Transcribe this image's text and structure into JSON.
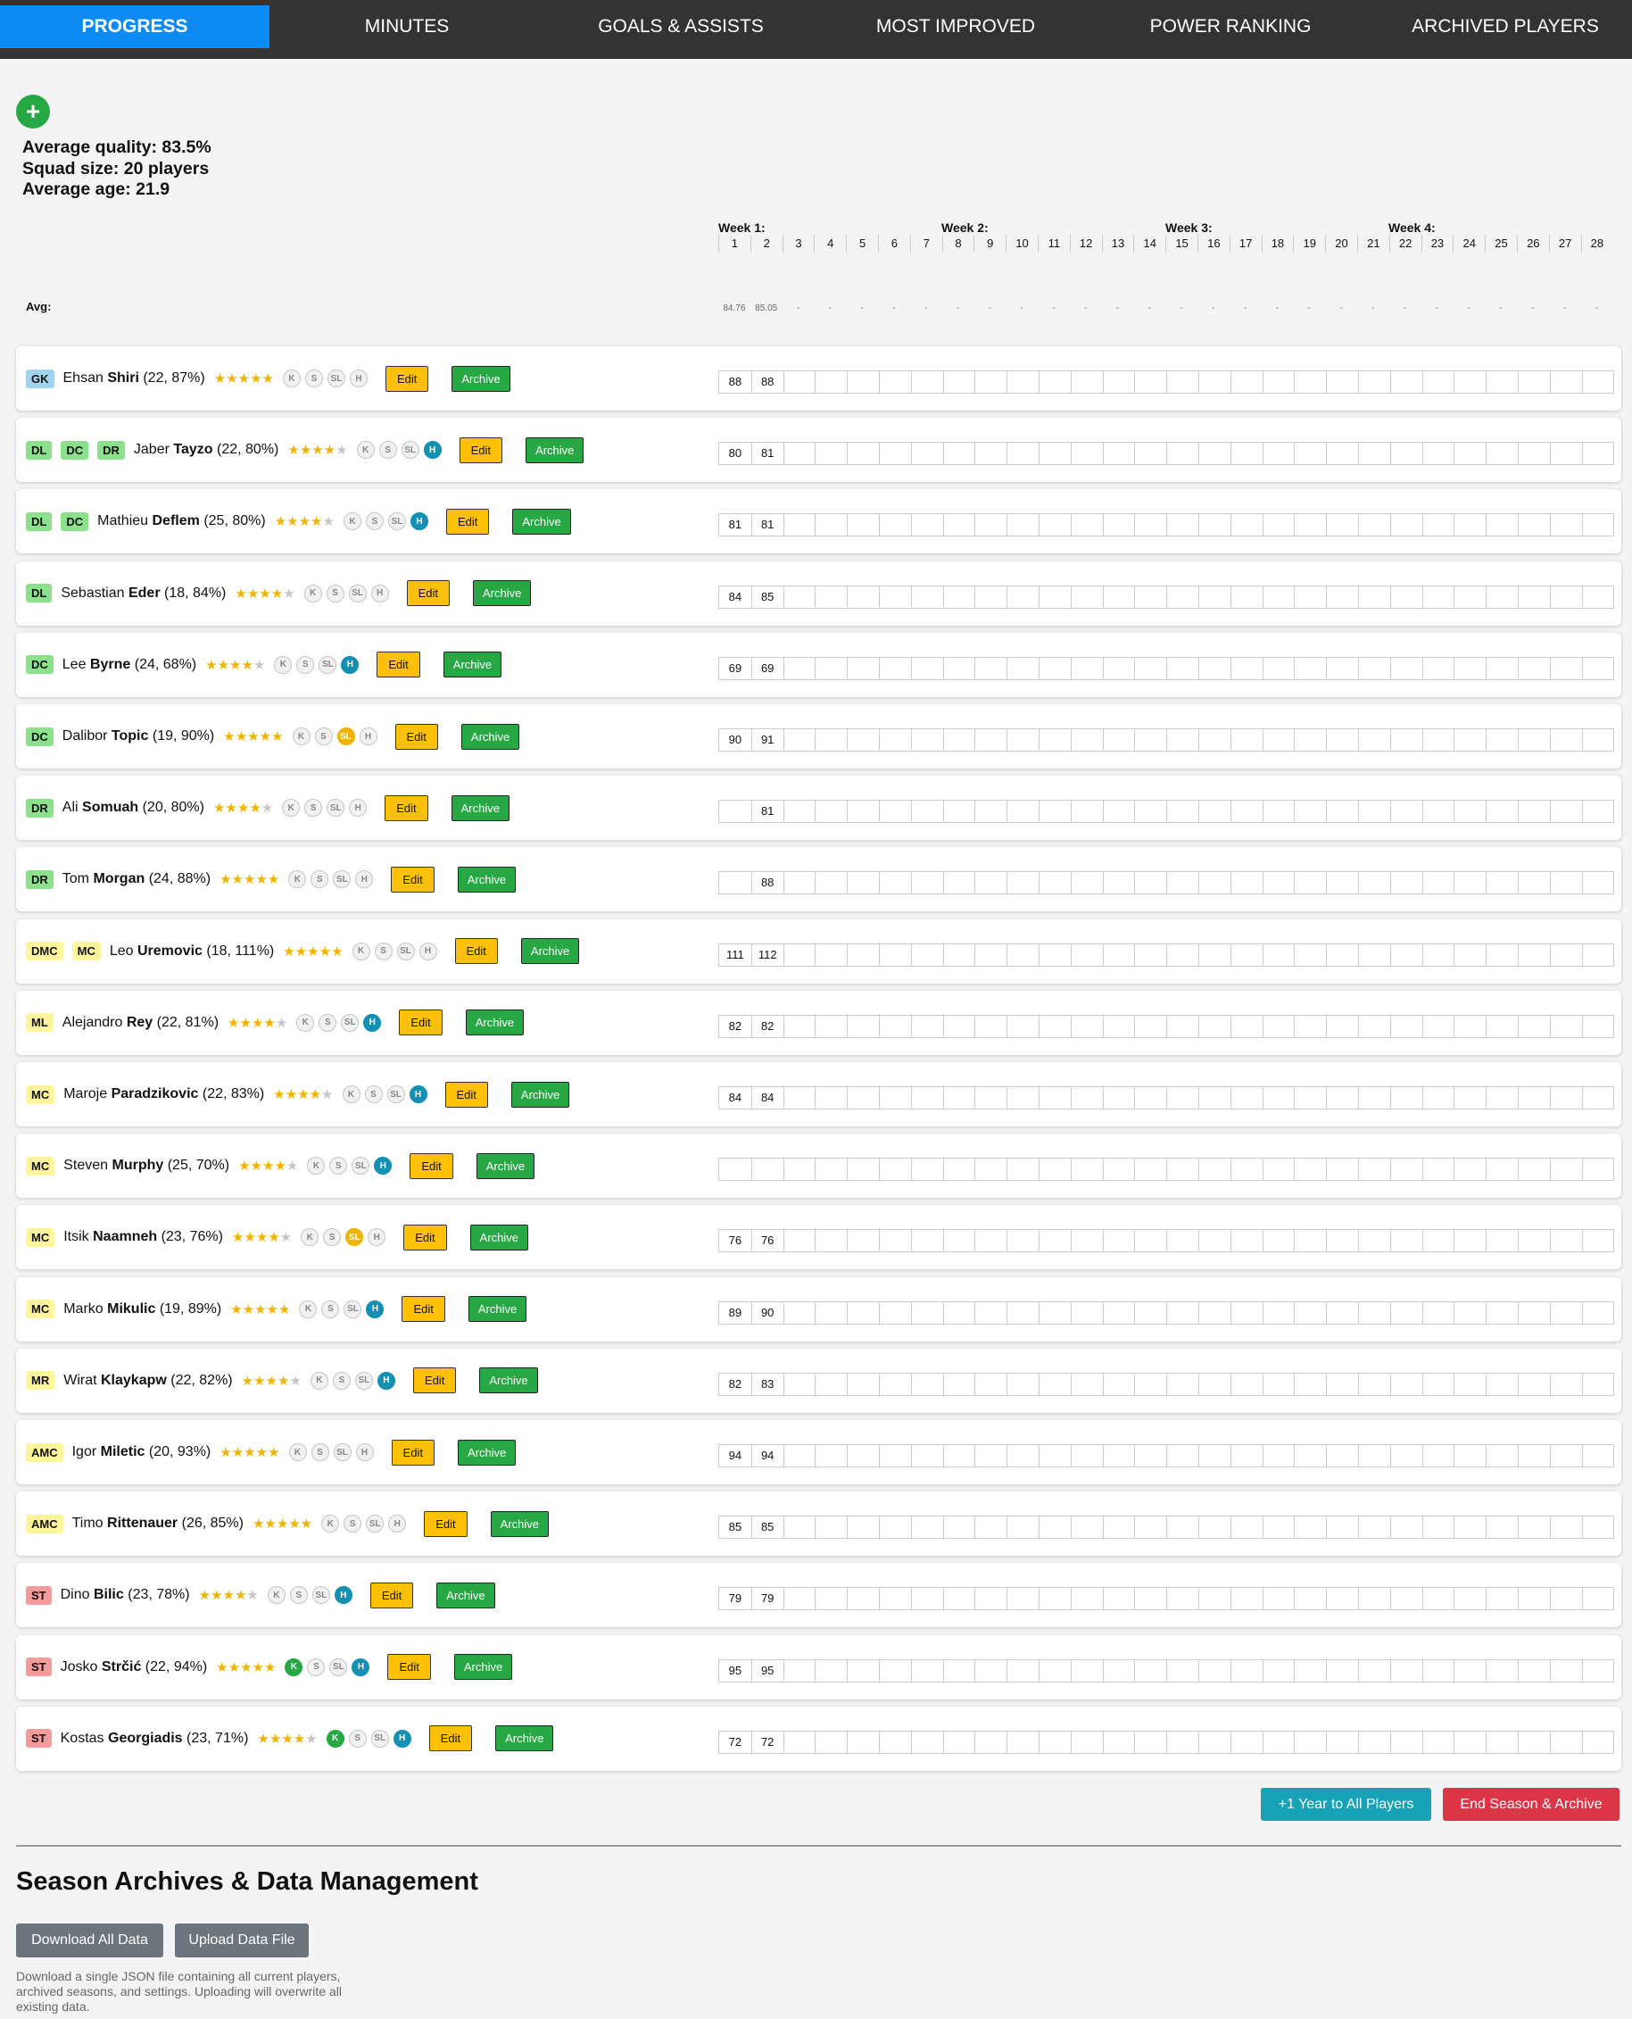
{
  "nav": {
    "tabs": [
      "PROGRESS",
      "MINUTES",
      "GOALS & ASSISTS",
      "MOST IMPROVED",
      "POWER RANKING",
      "ARCHIVED PLAYERS"
    ]
  },
  "add_button": "+",
  "stats": {
    "avg_quality": "Average quality: 83.5%",
    "squad_size": "Squad size: 20 players",
    "avg_age": "Average age: 21.9"
  },
  "weeks": [
    "Week 1:",
    "Week 2:",
    "Week 3:",
    "Week 4:"
  ],
  "avg_label": "Avg:",
  "averages": [
    "84.76",
    "85.05"
  ],
  "badge_labels": [
    "K",
    "S",
    "SL",
    "H"
  ],
  "edit_label": "Edit",
  "archive_label": "Archive",
  "players": [
    {
      "positions": [
        "GK"
      ],
      "first": "Ehsan",
      "last": "Shiri",
      "details": "(22, 87%)",
      "stars": 4.5,
      "badges": {
        "K": false,
        "S": false,
        "SL": false,
        "H": false
      },
      "values": [
        "88",
        "88"
      ]
    },
    {
      "positions": [
        "DL",
        "DC",
        "DR"
      ],
      "first": "Jaber",
      "last": "Tayzo",
      "details": "(22, 80%)",
      "stars": 4,
      "badges": {
        "K": false,
        "S": false,
        "SL": false,
        "H": true
      },
      "values": [
        "80",
        "81"
      ]
    },
    {
      "positions": [
        "DL",
        "DC"
      ],
      "first": "Mathieu",
      "last": "Deflem",
      "details": "(25, 80%)",
      "stars": 4,
      "badges": {
        "K": false,
        "S": false,
        "SL": false,
        "H": true
      },
      "values": [
        "81",
        "81"
      ]
    },
    {
      "positions": [
        "DL"
      ],
      "first": "Sebastian",
      "last": "Eder",
      "details": "(18, 84%)",
      "stars": 4,
      "badges": {
        "K": false,
        "S": false,
        "SL": false,
        "H": false
      },
      "values": [
        "84",
        "85"
      ]
    },
    {
      "positions": [
        "DC"
      ],
      "first": "Lee",
      "last": "Byrne",
      "details": "(24, 68%)",
      "stars": 3.5,
      "badges": {
        "K": false,
        "S": false,
        "SL": false,
        "H": true
      },
      "values": [
        "69",
        "69"
      ]
    },
    {
      "positions": [
        "DC"
      ],
      "first": "Dalibor",
      "last": "Topic",
      "details": "(19, 90%)",
      "stars": 4.5,
      "badges": {
        "K": false,
        "S": false,
        "SL": true,
        "H": false
      },
      "values": [
        "90",
        "91"
      ]
    },
    {
      "positions": [
        "DR"
      ],
      "first": "Ali",
      "last": "Somuah",
      "details": "(20, 80%)",
      "stars": 4,
      "badges": {
        "K": false,
        "S": false,
        "SL": false,
        "H": false
      },
      "values": [
        "",
        "81"
      ]
    },
    {
      "positions": [
        "DR"
      ],
      "first": "Tom",
      "last": "Morgan",
      "details": "(24, 88%)",
      "stars": 4.5,
      "badges": {
        "K": false,
        "S": false,
        "SL": false,
        "H": false
      },
      "values": [
        "",
        "88"
      ]
    },
    {
      "positions": [
        "DMC",
        "MC"
      ],
      "first": "Leo",
      "last": "Uremovic",
      "details": "(18, 111%)",
      "stars": 5,
      "badges": {
        "K": false,
        "S": false,
        "SL": false,
        "H": false
      },
      "values": [
        "111",
        "112"
      ]
    },
    {
      "positions": [
        "ML"
      ],
      "first": "Alejandro",
      "last": "Rey",
      "details": "(22, 81%)",
      "stars": 4,
      "badges": {
        "K": false,
        "S": false,
        "SL": false,
        "H": true
      },
      "values": [
        "82",
        "82"
      ]
    },
    {
      "positions": [
        "MC"
      ],
      "first": "Maroje",
      "last": "Paradzikovic",
      "details": "(22, 83%)",
      "stars": 4,
      "badges": {
        "K": false,
        "S": false,
        "SL": false,
        "H": true
      },
      "values": [
        "84",
        "84"
      ]
    },
    {
      "positions": [
        "MC"
      ],
      "first": "Steven",
      "last": "Murphy",
      "details": "(25, 70%)",
      "stars": 3.5,
      "badges": {
        "K": false,
        "S": false,
        "SL": false,
        "H": true
      },
      "values": [
        "",
        ""
      ]
    },
    {
      "positions": [
        "MC"
      ],
      "first": "Itsik",
      "last": "Naamneh",
      "details": "(23, 76%)",
      "stars": 4,
      "badges": {
        "K": false,
        "S": false,
        "SL": true,
        "H": false
      },
      "values": [
        "76",
        "76"
      ]
    },
    {
      "positions": [
        "MC"
      ],
      "first": "Marko",
      "last": "Mikulic",
      "details": "(19, 89%)",
      "stars": 4.5,
      "badges": {
        "K": false,
        "S": false,
        "SL": false,
        "H": true
      },
      "values": [
        "89",
        "90"
      ]
    },
    {
      "positions": [
        "MR"
      ],
      "first": "Wirat",
      "last": "Klaykapw",
      "details": "(22, 82%)",
      "stars": 4,
      "badges": {
        "K": false,
        "S": false,
        "SL": false,
        "H": true
      },
      "values": [
        "82",
        "83"
      ]
    },
    {
      "positions": [
        "AMC"
      ],
      "first": "Igor",
      "last": "Miletic",
      "details": "(20, 93%)",
      "stars": 5,
      "badges": {
        "K": false,
        "S": false,
        "SL": false,
        "H": false
      },
      "values": [
        "94",
        "94"
      ]
    },
    {
      "positions": [
        "AMC"
      ],
      "first": "Timo",
      "last": "Rittenauer",
      "details": "(26, 85%)",
      "stars": 4.5,
      "badges": {
        "K": false,
        "S": false,
        "SL": false,
        "H": false
      },
      "values": [
        "85",
        "85"
      ]
    },
    {
      "positions": [
        "ST"
      ],
      "first": "Dino",
      "last": "Bilic",
      "details": "(23, 78%)",
      "stars": 4,
      "badges": {
        "K": false,
        "S": false,
        "SL": false,
        "H": true
      },
      "values": [
        "79",
        "79"
      ]
    },
    {
      "positions": [
        "ST"
      ],
      "first": "Josko",
      "last": "Strčić",
      "details": "(22, 94%)",
      "stars": 5,
      "badges": {
        "K": true,
        "S": false,
        "SL": false,
        "H": true
      },
      "values": [
        "95",
        "95"
      ]
    },
    {
      "positions": [
        "ST"
      ],
      "first": "Kostas",
      "last": "Georgiadis",
      "details": "(23, 71%)",
      "stars": 3.5,
      "badges": {
        "K": true,
        "S": false,
        "SL": false,
        "H": true
      },
      "values": [
        "72",
        "72"
      ]
    }
  ],
  "footer": {
    "year_button": "+1 Year to All Players",
    "end_season_button": "End Season & Archive",
    "section_title": "Season Archives & Data Management",
    "download_button": "Download All Data",
    "upload_button": "Upload Data File",
    "help_text": "Download a single JSON file containing all current players, archived seasons, and settings. Uploading will overwrite all existing data."
  },
  "colors": {
    "nav_bg": "#333333",
    "active_tab": "#0d8bf2",
    "edit": "#ffc107",
    "archive": "#28a745",
    "year_button": "#17a2b8",
    "end_button": "#dc3545"
  }
}
